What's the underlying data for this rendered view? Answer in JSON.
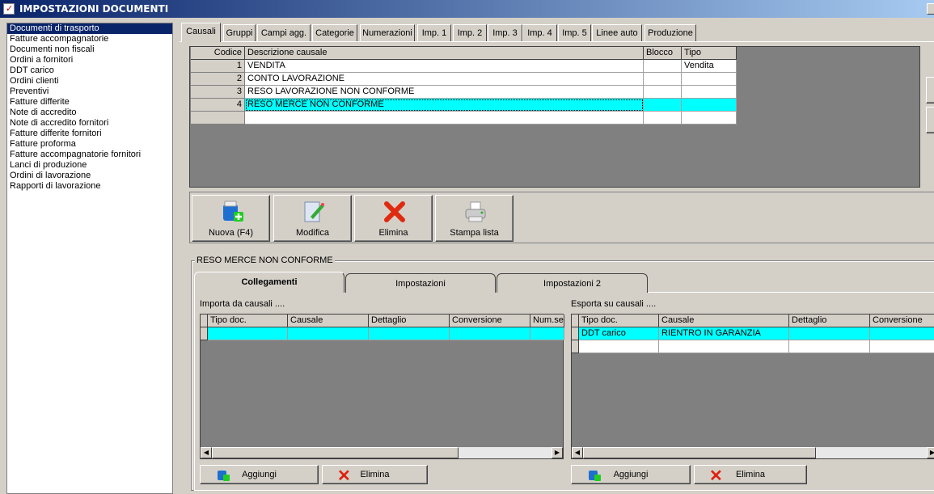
{
  "window": {
    "title": "IMPOSTAZIONI DOCUMENTI"
  },
  "sidebar": {
    "items": [
      "Documenti di trasporto",
      "Fatture accompagnatorie",
      "Documenti non fiscali",
      "Ordini a fornitori",
      "DDT carico",
      "Ordini clienti",
      "Preventivi",
      "Fatture differite",
      "Note di accredito",
      "Note di accredito fornitori",
      "Fatture differite fornitori",
      "Fatture proforma",
      "Fatture accompagnatorie fornitori",
      "Lanci di produzione",
      "Ordini di lavorazione",
      "Rapporti di lavorazione"
    ]
  },
  "tabs": [
    "Causali",
    "Gruppi",
    "Campi agg.",
    "Categorie",
    "Numerazioni",
    "Imp. 1",
    "Imp. 2",
    "Imp. 3",
    "Imp. 4",
    "Imp. 5",
    "Linee auto",
    "Produzione"
  ],
  "causali": {
    "headers": [
      "Codice",
      "Descrizione causale",
      "Blocco",
      "Tipo"
    ],
    "rows": [
      [
        "1",
        "VENDITA",
        "",
        "Vendita"
      ],
      [
        "2",
        "CONTO LAVORAZIONE",
        "",
        ""
      ],
      [
        "3",
        "RESO LAVORAZIONE NON CONFORME",
        "",
        ""
      ],
      [
        "4",
        "RESO MERCE NON CONFORME",
        "",
        ""
      ]
    ]
  },
  "toolbar": {
    "new": "Nuova (F4)",
    "edit": "Modifica",
    "delete": "Elimina",
    "print": "Stampa lista"
  },
  "detail": {
    "group_title": "RESO MERCE NON CONFORME",
    "subtabs": [
      "Collegamenti",
      "Impostazioni",
      "Impostazioni 2"
    ],
    "import": {
      "label": "Importa da causali ....",
      "headers": [
        "Tipo doc.",
        "Causale",
        "Dettaglio",
        "Conversione",
        "Num.se"
      ]
    },
    "export": {
      "label": "Esporta su causali ....",
      "headers": [
        "Tipo doc.",
        "Causale",
        "Dettaglio",
        "Conversione"
      ],
      "rows": [
        [
          "DDT carico",
          "RIENTRO IN GARANZIA",
          "",
          ""
        ]
      ]
    },
    "add": "Aggiungi",
    "remove": "Elimina"
  },
  "colors": {
    "selection": "#00ffff",
    "title_start": "#0a246a"
  }
}
